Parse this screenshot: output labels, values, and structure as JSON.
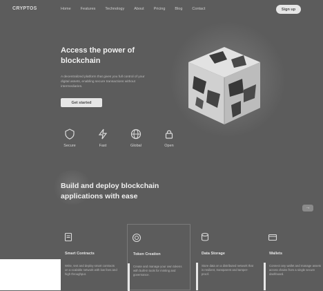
{
  "nav": {
    "logo": "CRYPTOS",
    "links": [
      "Home",
      "Features",
      "Technology",
      "About",
      "Pricing",
      "Blog",
      "Contact"
    ],
    "button_label": "Sign up"
  },
  "hero": {
    "title": "Access the power of blockchain",
    "description": "A decentralized platform that gives you full control of your digital assets, enabling secure transactions without intermediaries.",
    "cta_label": "Get started"
  },
  "features": [
    {
      "label": "Secure",
      "icon": "shield-icon"
    },
    {
      "label": "Fast",
      "icon": "bolt-icon"
    },
    {
      "label": "Global",
      "icon": "globe-icon"
    },
    {
      "label": "Open",
      "icon": "lock-icon"
    }
  ],
  "section": {
    "title": "Build and deploy blockchain applications with ease"
  },
  "cards": [
    {
      "title": "Smart Contracts",
      "text": "Write, test and deploy smart contracts on a scalable network with low fees and high throughput."
    },
    {
      "title": "Token Creation",
      "text": "Create and manage your own tokens with built-in tools for minting and governance."
    },
    {
      "title": "Data Storage",
      "text": "Store data on a distributed network that is resilient, transparent and tamper-proof."
    },
    {
      "title": "Wallets",
      "text": "Connect any wallet and manage assets across chains from a single secure dashboard."
    }
  ],
  "colors": {
    "background": "#5c5c5c",
    "accent": "#e6e6e6"
  }
}
